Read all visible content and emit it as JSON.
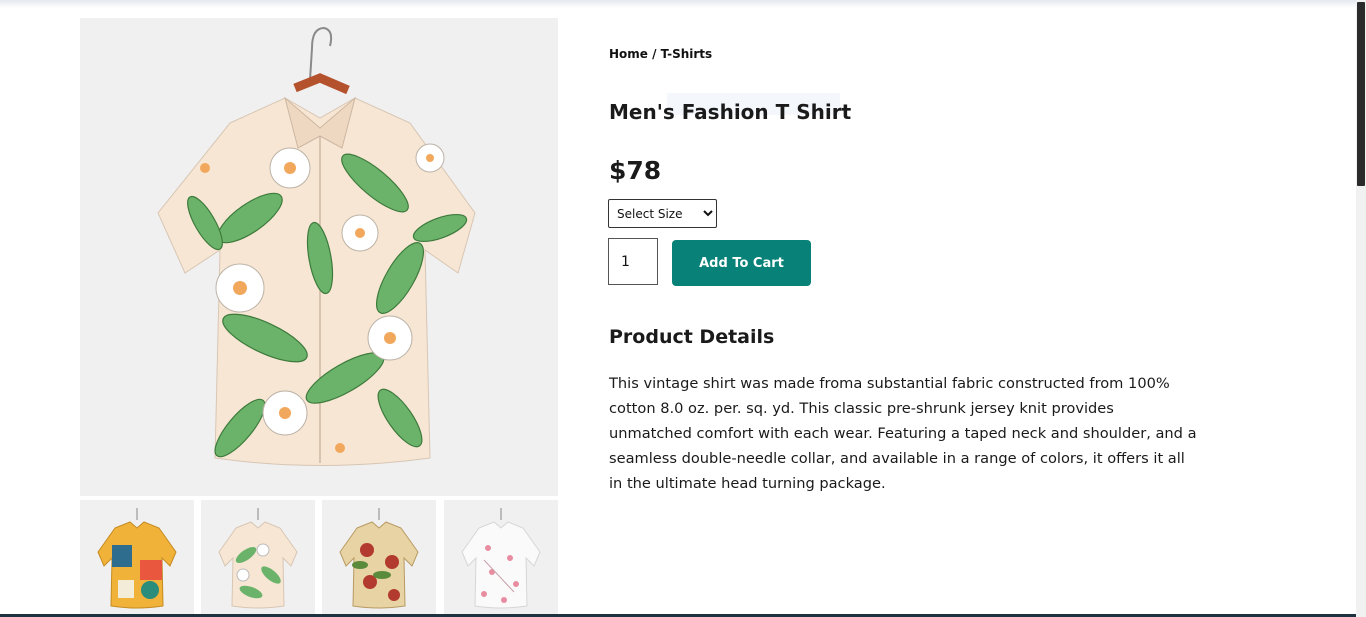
{
  "breadcrumb": "Home / T-Shirts",
  "product": {
    "title": "Men's Fashion T Shirt",
    "price": "$78",
    "size_select": {
      "selected": "Select Size",
      "options": [
        "Select Size"
      ]
    },
    "quantity": "1",
    "add_to_cart_label": "Add To Cart"
  },
  "details": {
    "heading": "Product Details",
    "text": "This vintage shirt was made froma substantial fabric constructed from 100% cotton 8.0 oz. per. sq. yd. This classic pre-shrunk jersey knit provides unmatched comfort with each wear. Featuring a taped neck and shoulder, and a seamless double-needle collar, and available in a range of colors, it offers it all in the ultimate head turning package."
  },
  "images": {
    "main": "floral-cream-green-shirt",
    "thumbnails": [
      "multicolor-pattern-shirt",
      "floral-cream-green-shirt",
      "floral-red-beige-shirt",
      "floral-pink-white-shirt"
    ]
  },
  "colors": {
    "accent": "#088178",
    "image_bg": "#f0f0f0"
  }
}
